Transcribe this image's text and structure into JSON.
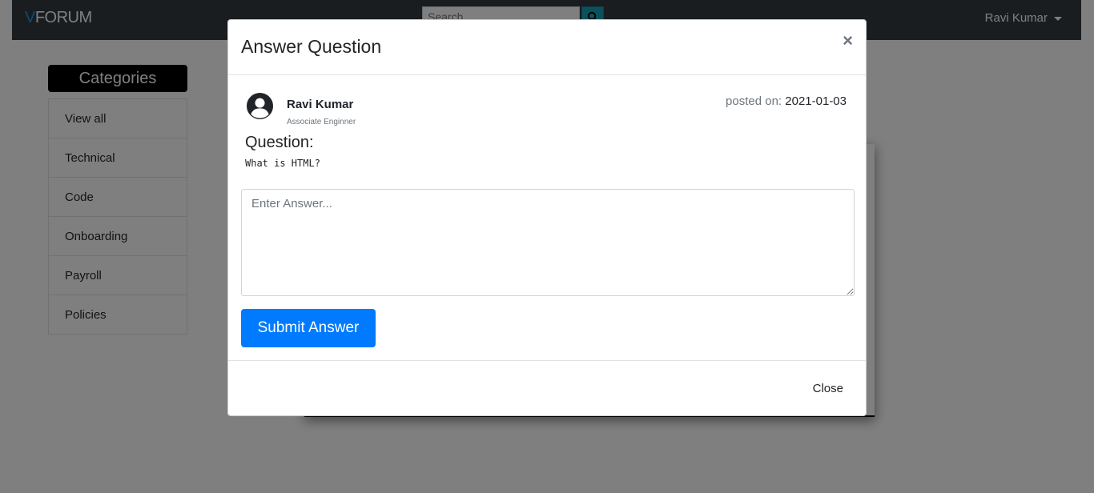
{
  "navbar": {
    "brand_prefix": "V",
    "brand_rest": "FORUM",
    "search_placeholder": "Search",
    "search_icon": "search-icon",
    "user_name": "Ravi Kumar"
  },
  "sidebar": {
    "title": "Categories",
    "items": [
      {
        "label": "View all"
      },
      {
        "label": "Technical"
      },
      {
        "label": "Code"
      },
      {
        "label": "Onboarding"
      },
      {
        "label": "Payroll"
      },
      {
        "label": "Policies"
      }
    ]
  },
  "modal": {
    "title": "Answer Question",
    "close_symbol": "×",
    "author": {
      "name": "Ravi Kumar",
      "role": "Associate Enginner",
      "avatar_icon": "user-circle-icon"
    },
    "posted_label": "posted on:",
    "posted_date": "2021-01-03",
    "question_label": "Question:",
    "question_text": "What is HTML?",
    "answer_placeholder": "Enter Answer...",
    "answer_value": "",
    "submit_label": "Submit Answer",
    "close_label": "Close"
  },
  "colors": {
    "navbar_bg": "#343a40",
    "brand_accent": "#0d9de8",
    "primary": "#007bff",
    "backdrop": "rgba(0,0,0,0.5)"
  }
}
